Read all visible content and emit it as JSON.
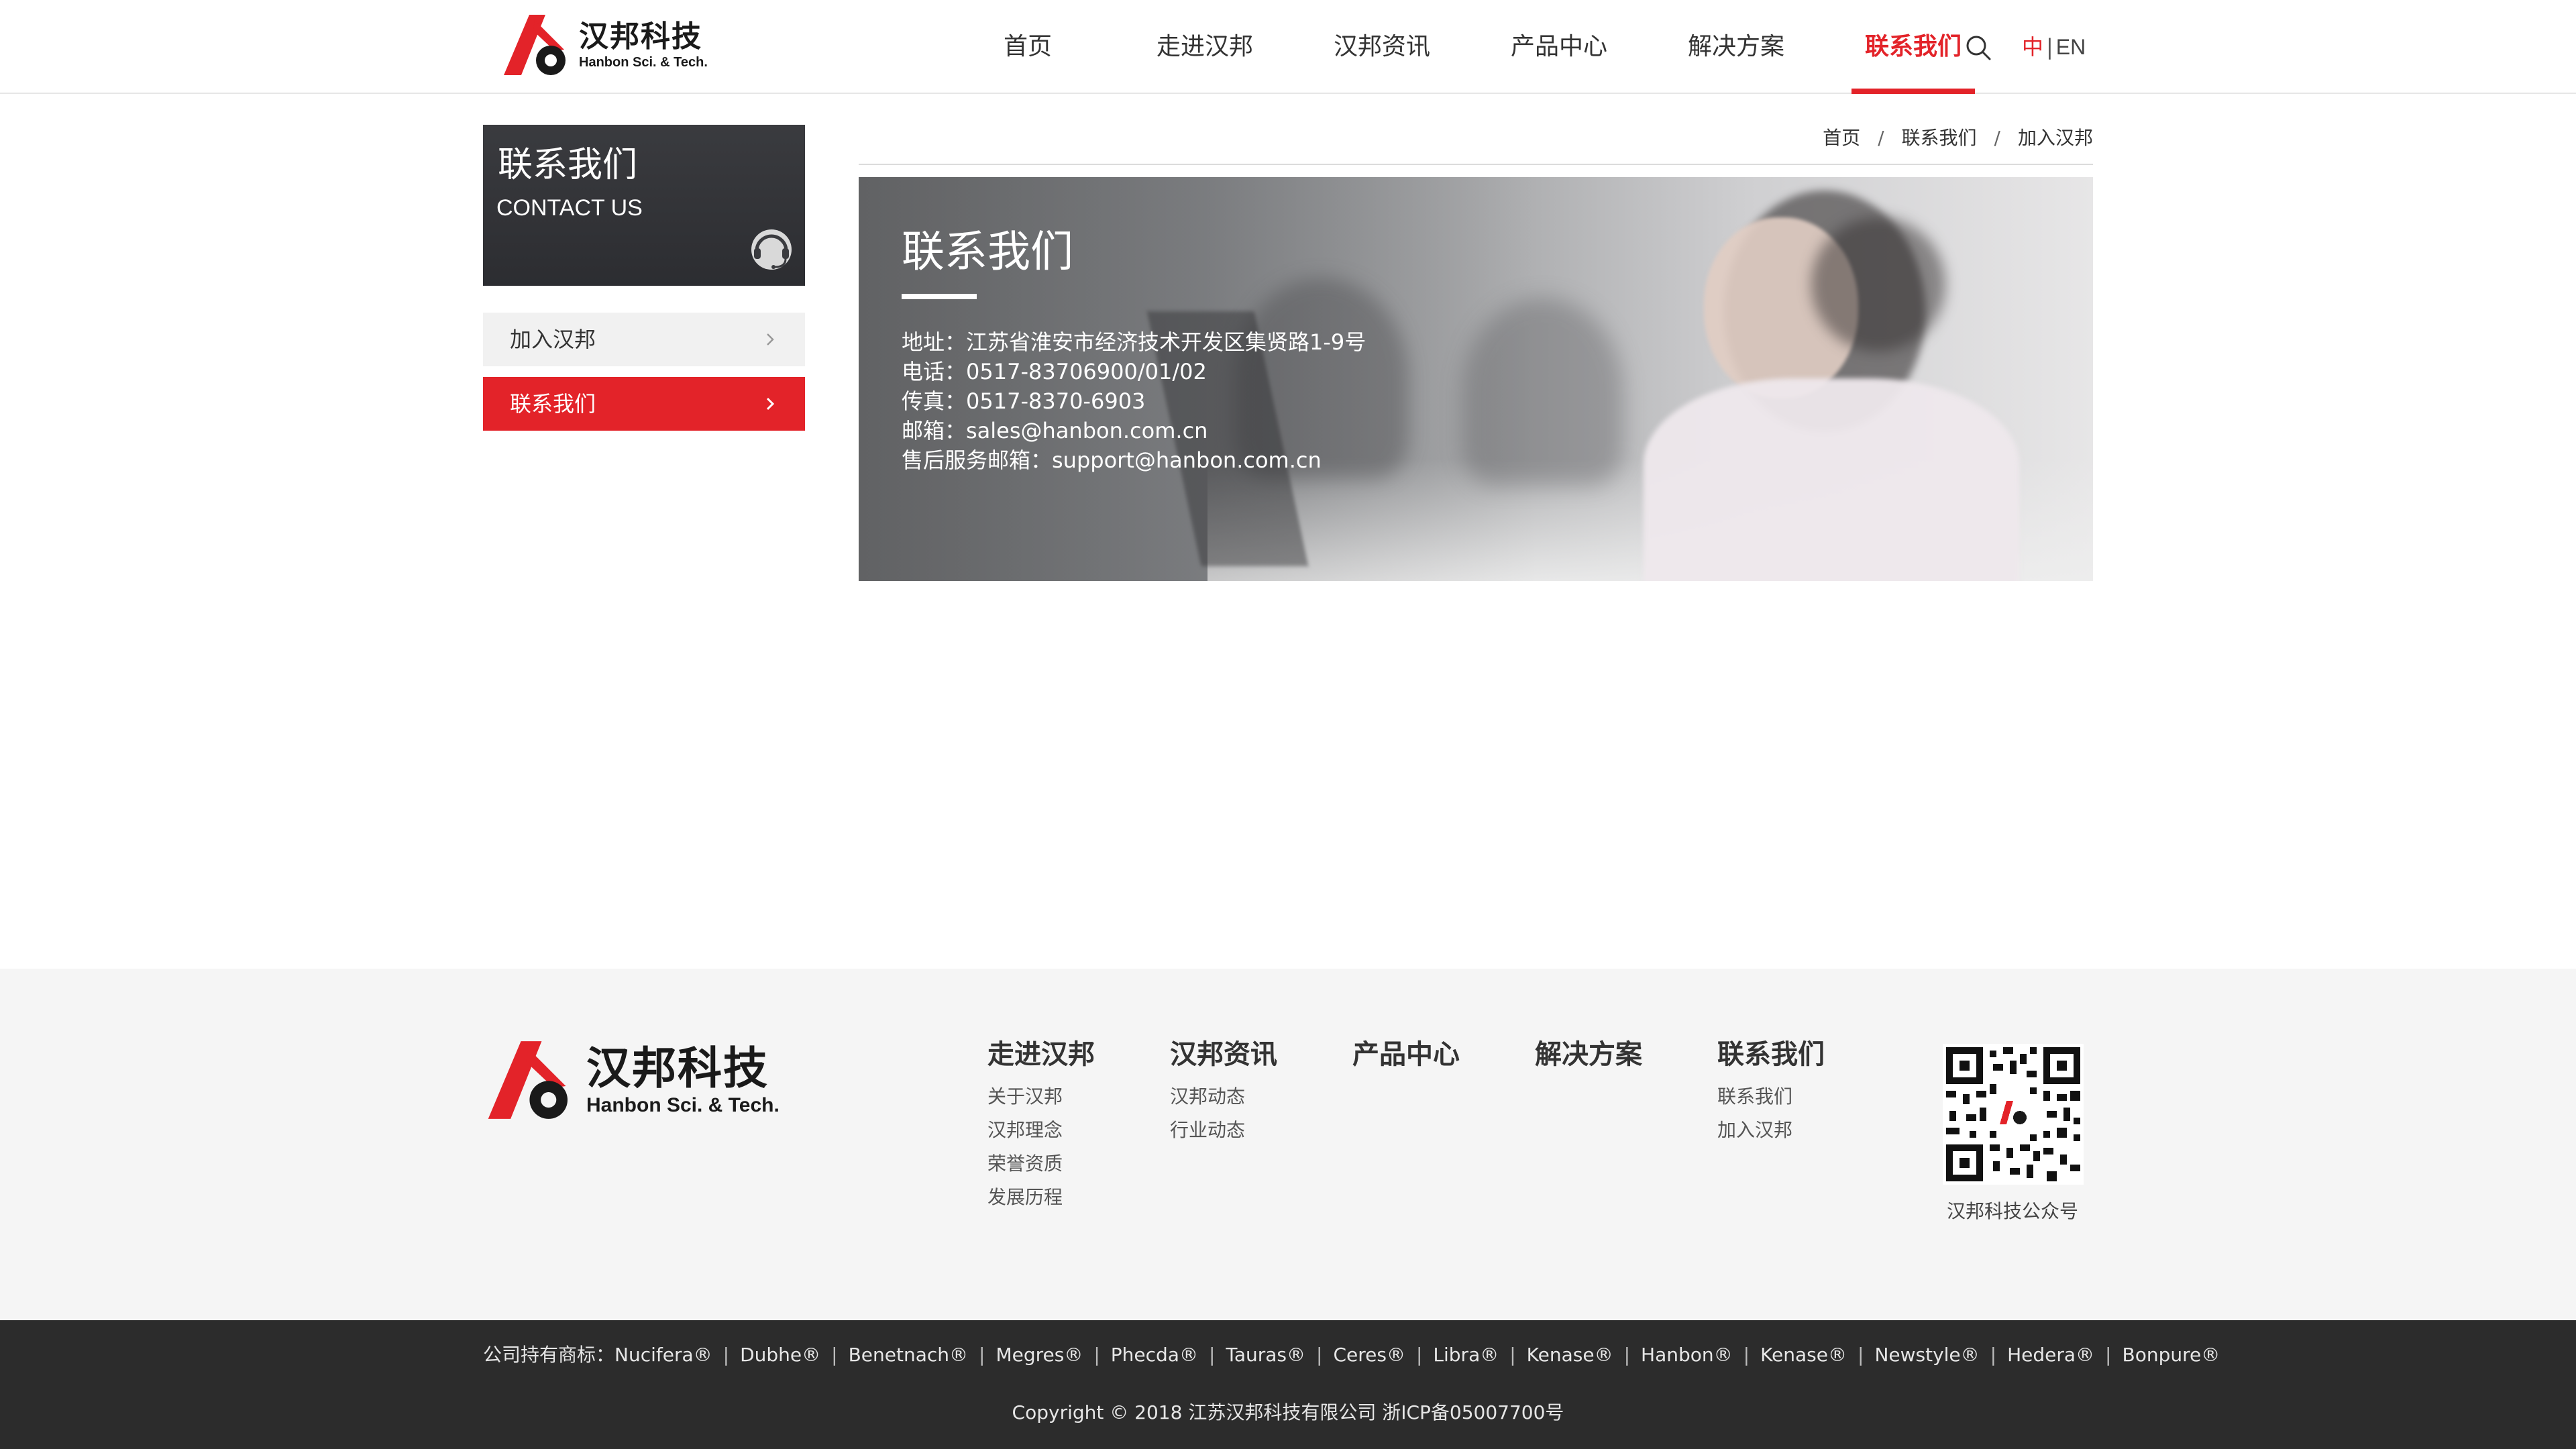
{
  "header": {
    "logo_cn": "汉邦科技",
    "logo_en": "Hanbon Sci. & Tech.",
    "nav": [
      "首页",
      "走进汉邦",
      "汉邦资讯",
      "产品中心",
      "解决方案",
      "联系我们"
    ],
    "active_nav": "联系我们",
    "lang_zh": "中",
    "lang_sep": "|",
    "lang_en": "EN"
  },
  "sidebar": {
    "title_cn": "联系我们",
    "title_en": "CONTACT US",
    "items": [
      {
        "label": "加入汉邦",
        "active": false
      },
      {
        "label": "联系我们",
        "active": true
      }
    ]
  },
  "breadcrumb": {
    "items": [
      "首页",
      "联系我们",
      "加入汉邦"
    ],
    "separator": "/"
  },
  "banner": {
    "title": "联系我们",
    "lines": [
      "地址：江苏省淮安市经济技术开发区集贤路1-9号",
      "电话：0517-83706900/01/02",
      "传真：0517-8370-6903",
      "邮箱：sales@hanbon.com.cn",
      "售后服务邮箱：support@hanbon.com.cn"
    ]
  },
  "footer": {
    "logo_cn": "汉邦科技",
    "logo_en": "Hanbon Sci. & Tech.",
    "columns": [
      {
        "title": "走进汉邦",
        "links": [
          "关于汉邦",
          "汉邦理念",
          "荣誉资质",
          "发展历程"
        ]
      },
      {
        "title": "汉邦资讯",
        "links": [
          "汉邦动态",
          "行业动态"
        ]
      },
      {
        "title": "产品中心",
        "links": []
      },
      {
        "title": "解决方案",
        "links": []
      },
      {
        "title": "联系我们",
        "links": [
          "联系我们",
          "加入汉邦"
        ]
      }
    ],
    "qr_label": "汉邦科技公众号",
    "trademarks_prefix": "公司持有商标：",
    "trademarks": [
      "Nucifera®",
      "Dubhe®",
      "Benetnach®",
      "Megres®",
      "Phecda®",
      "Tauras®",
      "Ceres®",
      "Libra®",
      "Kenase®",
      "Hanbon®",
      "Kenase®",
      "Newstyle®",
      "Hedera®",
      "Bonpure®"
    ],
    "copyright": "Copyright © 2018 江苏汉邦科技有限公司 浙ICP备05007700号"
  },
  "colors": {
    "brand_red": "#e32329",
    "sidebar_dark": "#2f3034",
    "footer_bg": "#f5f5f5",
    "bottom_bar": "#2c2c2c"
  },
  "icons": {
    "search": "search-icon",
    "headset": "headset-icon",
    "chevron": "chevron-right-icon"
  }
}
